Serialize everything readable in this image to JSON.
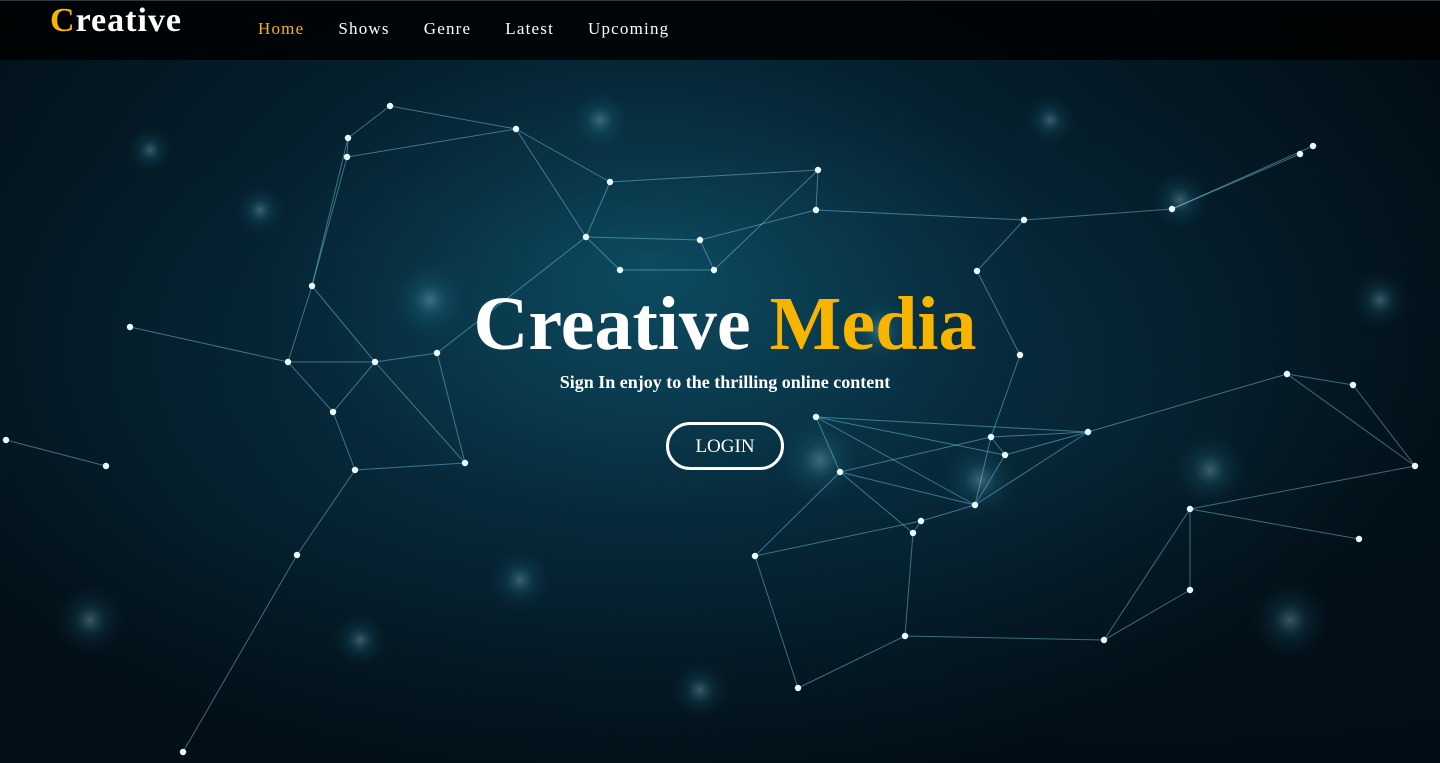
{
  "nav": {
    "brand_first": "C",
    "brand_rest": "reative",
    "links": [
      {
        "label": "Home"
      },
      {
        "label": "Shows"
      },
      {
        "label": "Genre"
      },
      {
        "label": "Latest"
      },
      {
        "label": "Upcoming"
      }
    ]
  },
  "hero": {
    "title_main": "Creative",
    "title_accent": "Media",
    "subtitle": "Sign In enjoy to the thrilling online content",
    "login_label": "LOGIN"
  },
  "colors": {
    "accent": "#f7b500",
    "text": "#ffffff",
    "navbar": "#000000",
    "background": "#03131c",
    "network_line": "#7fd6f0"
  },
  "background": {
    "icon": "network-plexus-image"
  }
}
